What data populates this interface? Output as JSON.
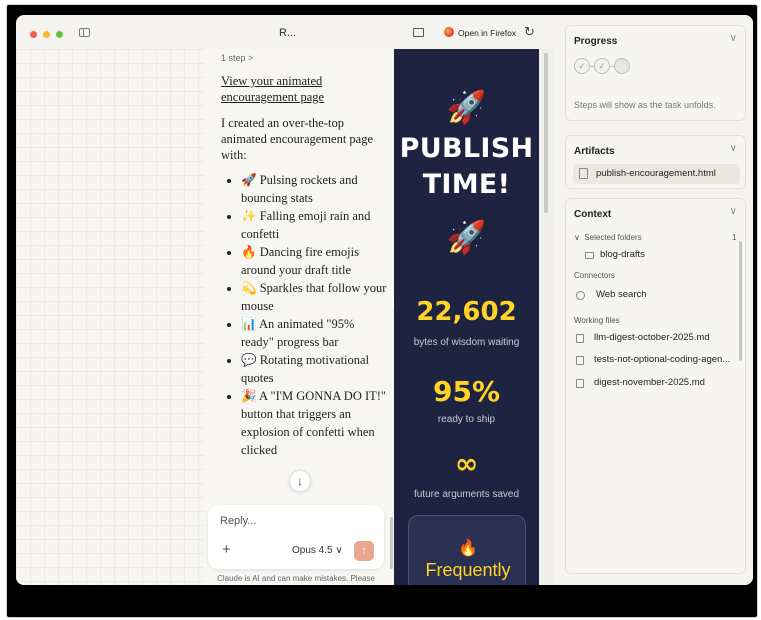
{
  "window": {
    "title": "R..."
  },
  "chat": {
    "step": "1 step",
    "step_chevron": ">",
    "link": "View your animated encouragement page",
    "intro": "I created an over-the-top animated encouragement page with:",
    "bullets": [
      "🚀 Pulsing rockets and bouncing stats",
      "✨ Falling emoji rain and confetti",
      "🔥 Dancing fire emojis around your draft title",
      "💫 Sparkles that follow your mouse",
      "📊 An animated \"95% ready\" progress bar",
      "💬 Rotating motivational quotes",
      "🎉 A \"I'M GONNA DO IT!\" button that triggers an explosion of confetti when clicked"
    ],
    "scroll_down_icon": "↓",
    "composer": {
      "placeholder": "Reply...",
      "plus": "+",
      "model": "Opus 4.5 ∨",
      "send_icon": "↑"
    },
    "disclaimer": "Claude is AI and can make mistakes. Please double-check responses."
  },
  "preview_toolbar": {
    "open_label": "Open in Firefox",
    "reload_icon": "↻"
  },
  "preview": {
    "rocket_emoji": "🚀",
    "headline_line1": "PUBLISH",
    "headline_line2": "TIME!",
    "stats": [
      {
        "value": "22,602",
        "label": "bytes of wisdom waiting"
      },
      {
        "value": "95%",
        "label": "ready to ship"
      },
      {
        "value": "∞",
        "label": "future arguments saved"
      }
    ],
    "card_emoji": "🔥",
    "card_title": "Frequently"
  },
  "panel": {
    "progress": {
      "title": "Progress",
      "chevron": "∨",
      "check": "✓",
      "note": "Steps will show as the task unfolds."
    },
    "artifacts": {
      "title": "Artifacts",
      "chevron": "∨",
      "file": "publish-encouragement.html"
    },
    "context": {
      "title": "Context",
      "chevron": "∨",
      "selected_folders_label": "Selected folders",
      "selected_folders_count": "1",
      "folder_chevron": "∨",
      "folder": "blog-drafts",
      "connectors_label": "Connectors",
      "connector": "Web search",
      "working_files_label": "Working files",
      "files": [
        "llm-digest-october-2025.md",
        "tests-not-optional-coding-agen...",
        "digest-november-2025.md"
      ]
    }
  }
}
